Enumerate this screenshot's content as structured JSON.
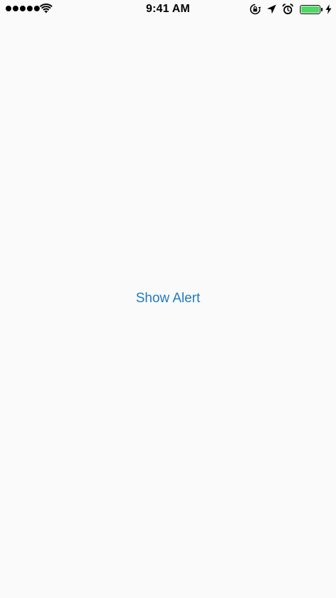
{
  "status_bar": {
    "time": "9:41 AM",
    "signal_bars": 5,
    "battery_level": 1.0,
    "battery_color": "#4cd964",
    "icons": [
      "signal-icon",
      "wifi-icon",
      "orientation-lock-icon",
      "location-arrow-icon",
      "alarm-icon",
      "battery-icon",
      "charging-bolt-icon"
    ]
  },
  "main": {
    "button_label": "Show Alert",
    "button_color": "#1f7ac4"
  }
}
